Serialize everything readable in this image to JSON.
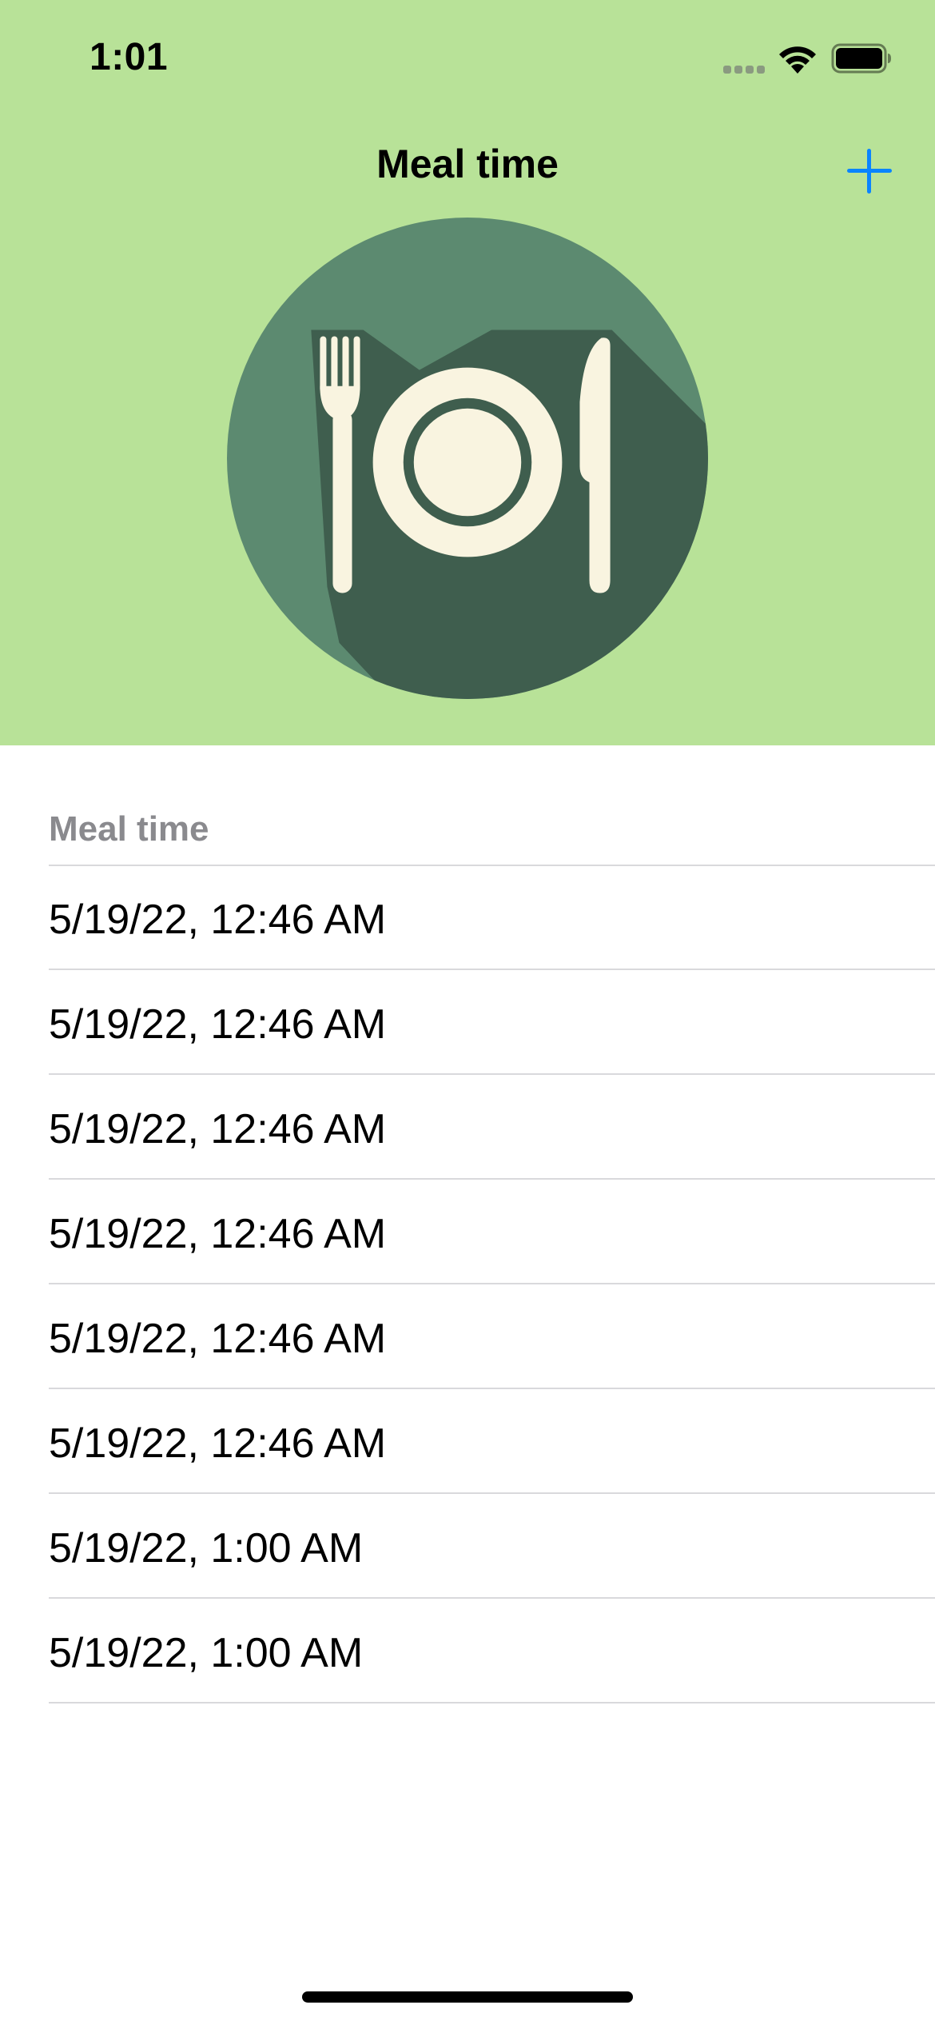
{
  "status_bar": {
    "time": "1:01",
    "icons": [
      "cellular-signal-icon",
      "wifi-icon",
      "battery-icon"
    ]
  },
  "nav": {
    "title": "Meal time",
    "add_icon": "plus-icon"
  },
  "illustration": {
    "icon": "plate-fork-knife-icon",
    "colors": {
      "circle": "#5c8a70",
      "shadow": "#3f5e4e",
      "cutlery": "#f9f4e0"
    }
  },
  "list": {
    "section_header": "Meal time",
    "items": [
      "5/19/22, 12:46 AM",
      "5/19/22, 12:46 AM",
      "5/19/22, 12:46 AM",
      "5/19/22, 12:46 AM",
      "5/19/22, 12:46 AM",
      "5/19/22, 12:46 AM",
      "5/19/22, 1:00 AM",
      "5/19/22, 1:00 AM"
    ]
  },
  "colors": {
    "header_background": "#b8e298",
    "accent": "#0a84ff",
    "section_header_text": "#8a8a8e",
    "divider": "#d9d9dc"
  }
}
